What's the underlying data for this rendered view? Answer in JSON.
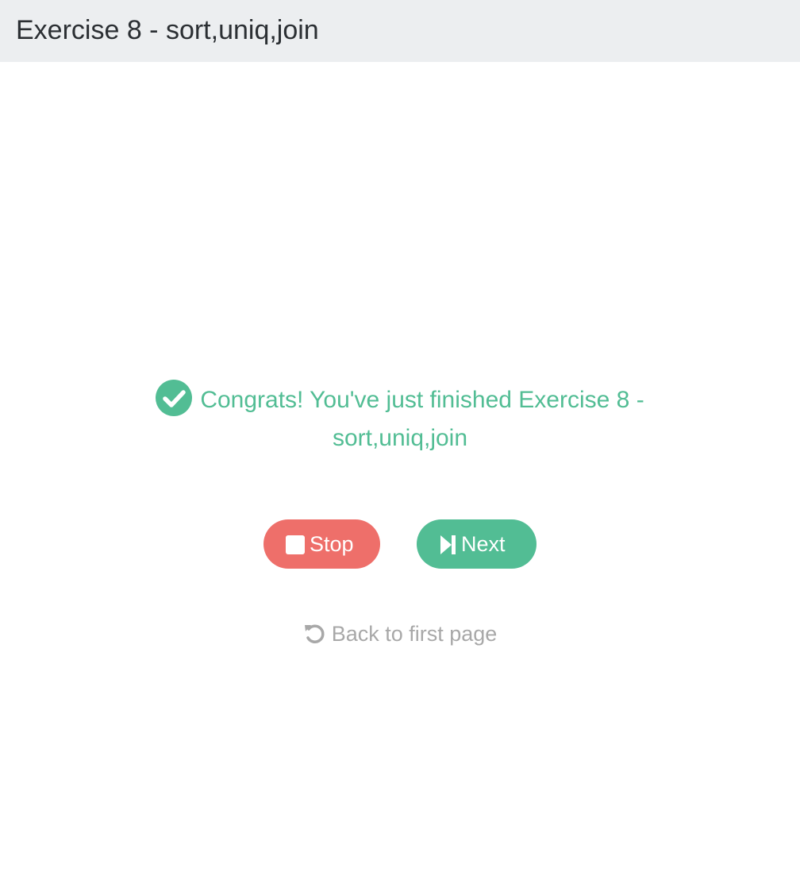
{
  "header": {
    "title": "Exercise 8 - sort,uniq,join"
  },
  "message": {
    "icon": "check-circle-icon",
    "text": "Congrats! You've just finished Exercise 8 - sort,uniq,join",
    "color": "#52bd94"
  },
  "actions": {
    "stop_label": "Stop",
    "stop_icon": "stop-icon",
    "stop_color": "#ee6f6a",
    "next_label": "Next",
    "next_icon": "step-forward-icon",
    "next_color": "#52bd94"
  },
  "back_link": {
    "label": "Back to first page",
    "icon": "undo-icon"
  }
}
